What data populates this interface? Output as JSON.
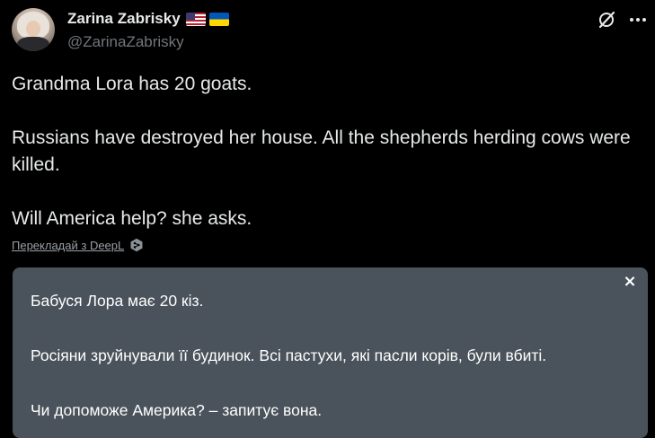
{
  "author": {
    "display_name": "Zarina Zabrisky",
    "handle": "@ZarinaZabrisky",
    "flags": [
      "us-flag-icon",
      "ukraine-flag-icon"
    ]
  },
  "header_icons": [
    "grok-icon",
    "more-icon"
  ],
  "tweet": {
    "lines": [
      "Grandma Lora has 20 goats.",
      "Russians have destroyed her house. All the shepherds herding cows were killed.",
      "Will America help? she asks."
    ]
  },
  "translate": {
    "link_label": "Перекладай з DeepL",
    "icon": "deepl-icon"
  },
  "translation_panel": {
    "close_label": "×",
    "lines": [
      "Бабуся Лора має 20 кіз.",
      "Росіяни зруйнували її будинок. Всі пастухи, які пасли корів, були вбиті.",
      "Чи допоможе Америка? – запитує вона."
    ]
  },
  "colors": {
    "background": "#000000",
    "primary_text": "#e7e9ea",
    "secondary_text": "#71767b",
    "translation_bg": "#4a535b"
  }
}
